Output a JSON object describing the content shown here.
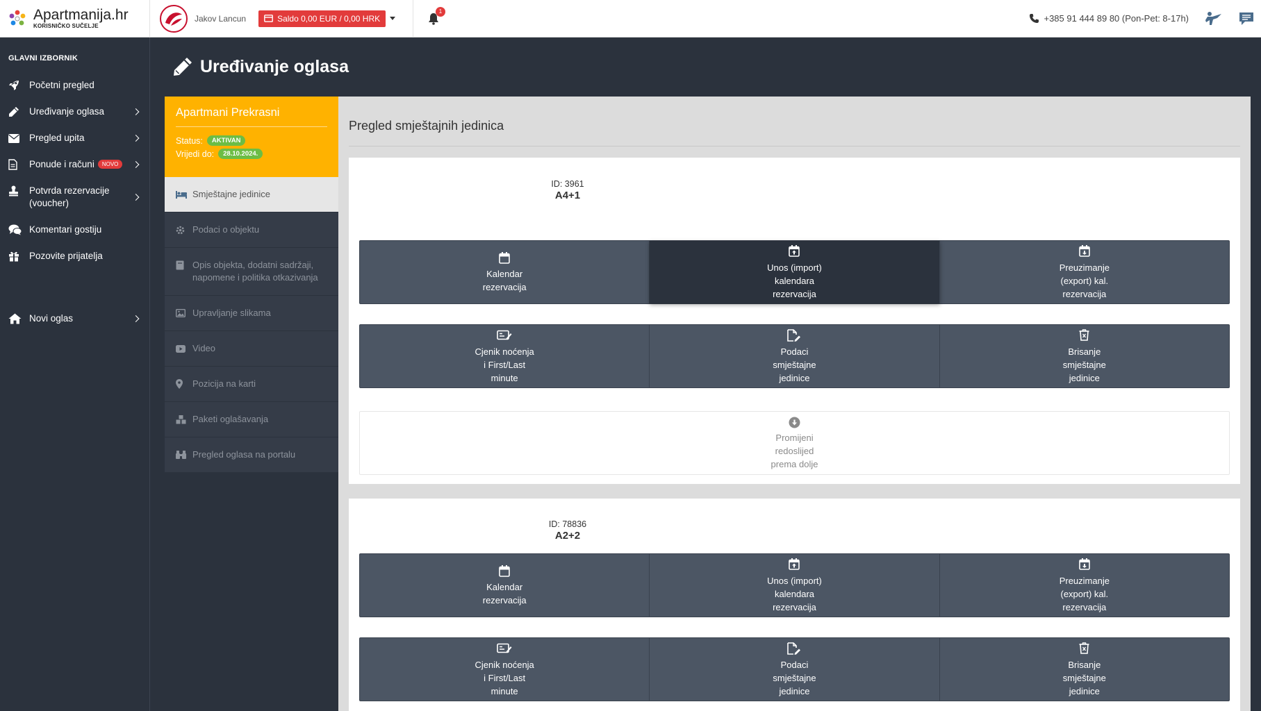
{
  "brand": {
    "name": "Apartmanija.hr",
    "subtitle": "KORISNIČKO SUČELJE"
  },
  "header": {
    "user_name": "Jakov Lancun",
    "saldo": "Saldo 0,00 EUR / 0,00 HRK",
    "notifications": "1",
    "phone": "+385 91 444 89 80 (Pon-Pet: 8-17h)"
  },
  "sidebar": {
    "title": "GLAVNI IZBORNIK",
    "items": [
      {
        "label": "Početni pregled",
        "icon": "rocket-icon"
      },
      {
        "label": "Uređivanje oglasa",
        "icon": "pencil-icon",
        "has_arrow": true
      },
      {
        "label": "Pregled upita",
        "icon": "envelope-icon",
        "has_arrow": true
      },
      {
        "label": "Ponude i računi",
        "icon": "document-icon",
        "has_arrow": true,
        "badge": "NOVO"
      },
      {
        "label": "Potvrda rezervacije (voucher)",
        "icon": "stamp-icon",
        "has_arrow": true
      },
      {
        "label": "Komentari gostiju",
        "icon": "comments-icon"
      },
      {
        "label": "Pozovite prijatelja",
        "icon": "gift-icon"
      },
      {
        "label": "Novi oglas",
        "icon": "home-icon",
        "has_arrow": true
      }
    ]
  },
  "page": {
    "title": "Uređivanje oglasa"
  },
  "listing": {
    "name": "Apartmani Prekrasni",
    "status_label": "Status:",
    "status_value": "AKTIVAN",
    "valid_label": "Vrijedi do:",
    "valid_value": "28.10.2024.",
    "nav": [
      {
        "label": "Smještajne jedinice",
        "icon": "bed-icon",
        "active": true
      },
      {
        "label": "Podaci o objektu",
        "icon": "gear-icon"
      },
      {
        "label": "Opis objekta, dodatni sadržaji, napomene i politika otkazivanja",
        "icon": "book-icon"
      },
      {
        "label": "Upravljanje slikama",
        "icon": "image-icon"
      },
      {
        "label": "Video",
        "icon": "video-icon"
      },
      {
        "label": "Pozicija na karti",
        "icon": "map-pin-icon"
      },
      {
        "label": "Paketi oglašavanja",
        "icon": "cubes-icon"
      },
      {
        "label": "Pregled oglasa na portalu",
        "icon": "binoculars-icon"
      }
    ]
  },
  "main": {
    "section_title": "Pregled smještajnih jedinica",
    "units": [
      {
        "id_label": "ID: 3961",
        "name": "A4+1"
      },
      {
        "id_label": "ID: 78836",
        "name": "A2+2"
      }
    ],
    "buttons": {
      "calendar": [
        "Kalendar",
        "rezervacija"
      ],
      "import": [
        "Unos (import)",
        "kalendara",
        "rezervacija"
      ],
      "export": [
        "Preuzimanje",
        "(export) kal.",
        "rezervacija"
      ],
      "pricing": [
        "Cjenik noćenja",
        "i First/Last",
        "minute"
      ],
      "unit_data": [
        "Podaci",
        "smještajne",
        "jedinice"
      ],
      "delete": [
        "Brisanje",
        "smještajne",
        "jedinice"
      ],
      "reorder": [
        "Promijeni",
        "redoslijed",
        "prema dolje"
      ]
    }
  },
  "colors": {
    "sidebar_bg": "#2b323d",
    "accent_orange": "#ffb200",
    "button_bg": "#4c5664",
    "saldo_red": "#e23b3b",
    "status_green": "#6cbd45"
  }
}
